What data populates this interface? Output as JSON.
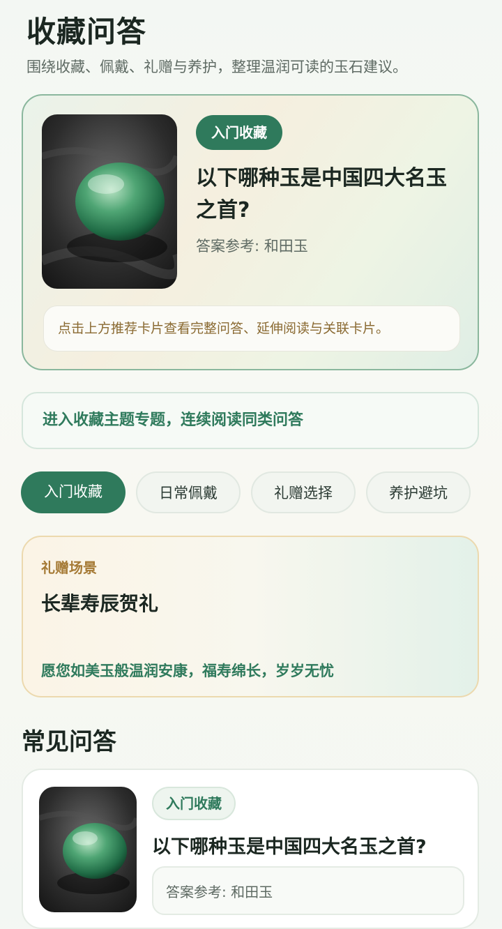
{
  "header": {
    "title": "收藏问答",
    "subtitle": "围绕收藏、佩戴、礼赠与养护，整理温润可读的玉石建议。"
  },
  "featured": {
    "tag": "入门收藏",
    "question": "以下哪种玉是中国四大名玉之首?",
    "answer": "答案参考: 和田玉",
    "hint": "点击上方推荐卡片查看完整问答、延伸阅读与关联卡片。"
  },
  "topic_link": "进入收藏主题专题，连续阅读同类问答",
  "tabs": [
    {
      "label": "入门收藏",
      "active": true
    },
    {
      "label": "日常佩戴",
      "active": false
    },
    {
      "label": "礼赠选择",
      "active": false
    },
    {
      "label": "养护避坑",
      "active": false
    }
  ],
  "gift": {
    "scene": "礼赠场景",
    "title": "长辈寿辰贺礼",
    "wish": "愿您如美玉般温润安康，福寿绵长，岁岁无忧"
  },
  "faq": {
    "heading": "常见问答",
    "items": [
      {
        "tag": "入门收藏",
        "question": "以下哪种玉是中国四大名玉之首?",
        "answer": "答案参考: 和田玉"
      }
    ]
  },
  "colors": {
    "accent": "#2f7a5c",
    "gold": "#a57a35",
    "text": "#1b2721"
  }
}
